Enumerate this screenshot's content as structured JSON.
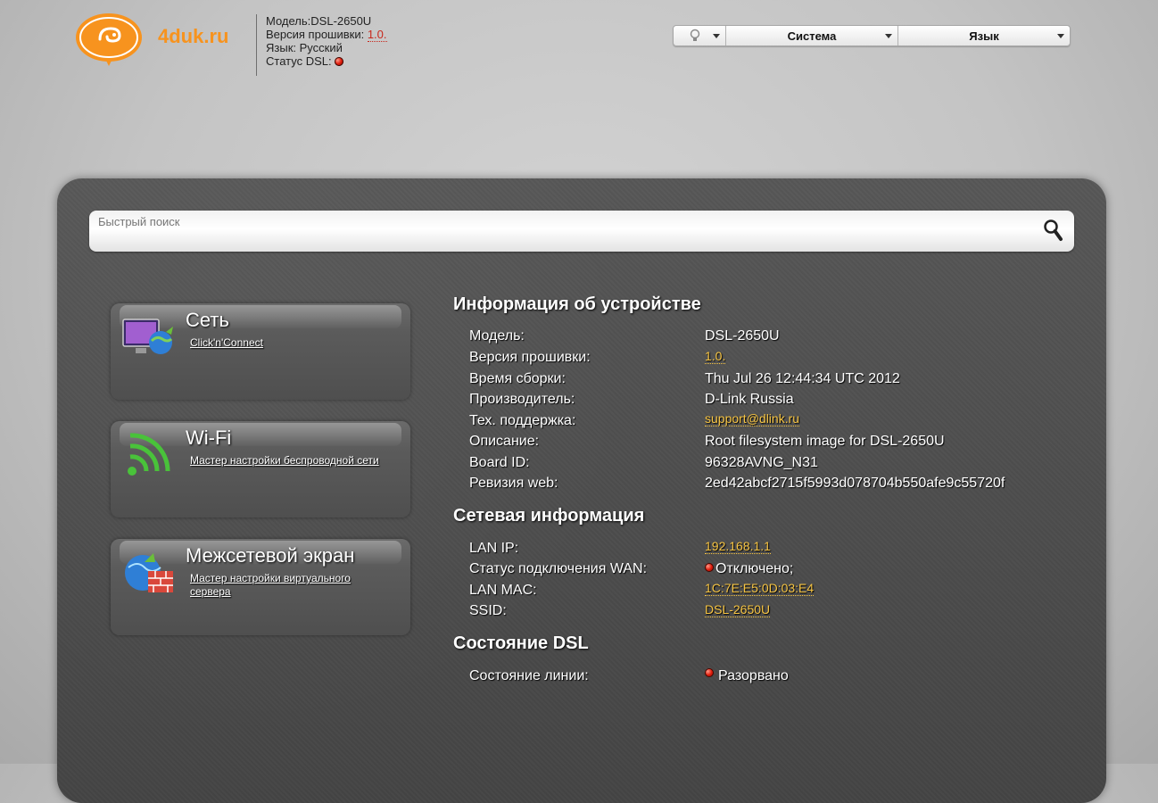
{
  "header": {
    "logo_text": "4duk.ru",
    "model": "Модель:DSL-2650U",
    "firmware_label": "Версия прошивки:",
    "firmware_value": "1.0.",
    "language": "Язык: Русский",
    "dsl_status_label": "Статус DSL:"
  },
  "topmenu": {
    "system": "Система",
    "language": "Язык"
  },
  "search": {
    "placeholder": "Быстрый поиск"
  },
  "cards": [
    {
      "title": "Сеть",
      "link": "Click'n'Connect"
    },
    {
      "title": "Wi-Fi",
      "link": "Мастер настройки беспроводной сети"
    },
    {
      "title": "Межсетевой экран",
      "link": "Мастер настройки виртуального сервера"
    }
  ],
  "device_info": {
    "title": "Информация об устройстве",
    "rows": [
      {
        "label": "Модель:",
        "value": "DSL-2650U"
      },
      {
        "label": "Версия прошивки:",
        "value": "1.0."
      },
      {
        "label": "Время сборки:",
        "value": "Thu Jul 26 12:44:34 UTC 2012"
      },
      {
        "label": "Производитель:",
        "value": "D-Link Russia"
      },
      {
        "label": "Тех. поддержка:",
        "value": "support@dlink.ru"
      },
      {
        "label": "Описание:",
        "value": "Root filesystem image for DSL-2650U"
      },
      {
        "label": "Board ID:",
        "value": "96328AVNG_N31"
      },
      {
        "label": "Ревизия web:",
        "value": "2ed42abcf2715f5993d078704b550afe9c55720f"
      }
    ]
  },
  "network_info": {
    "title": "Сетевая информация",
    "rows": [
      {
        "label": "LAN IP:",
        "value": "192.168.1.1"
      },
      {
        "label": "Статус подключения WAN:",
        "value": "Отключено;"
      },
      {
        "label": "LAN MAC:",
        "value": "1C:7E:E5:0D:03:E4"
      },
      {
        "label": "SSID:",
        "value": "DSL-2650U"
      }
    ]
  },
  "dsl_info": {
    "title": "Состояние DSL",
    "rows": [
      {
        "label": "Состояние линии:",
        "value": "Разорвано"
      }
    ]
  },
  "colors": {
    "accent_orange": "#f7931e",
    "link_yellow": "#f6c443",
    "firmware_red": "#c8281c",
    "status_red": "#e11d0c"
  }
}
